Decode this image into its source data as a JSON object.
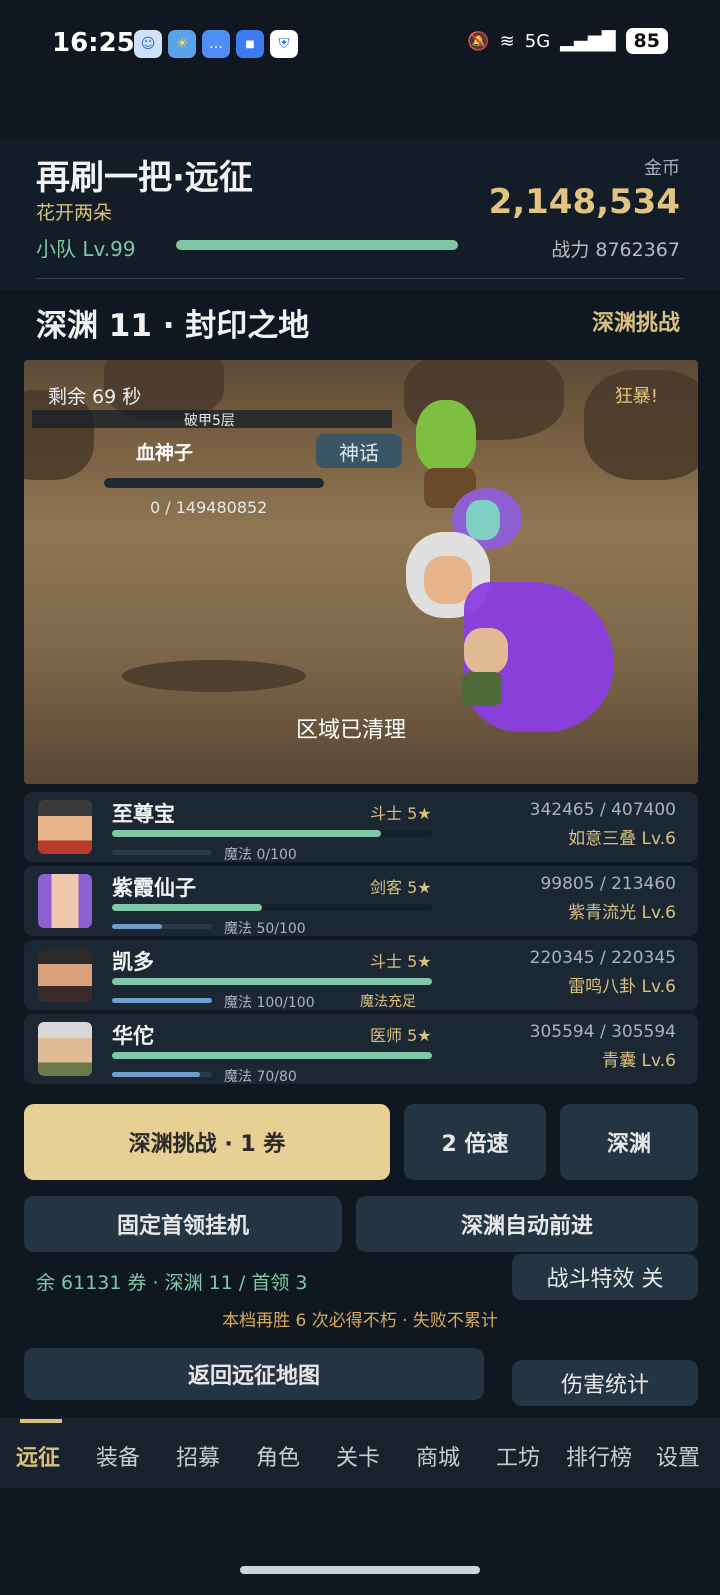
{
  "status_bar": {
    "time": "16:25",
    "signal": "5G",
    "battery": "85"
  },
  "header": {
    "title": "再刷一把·远征",
    "subtitle": "花开两朵",
    "team_level": "小队 Lv.99",
    "gold_label": "金币",
    "gold_value": "2,148,534",
    "power": "战力 8762367"
  },
  "stage": {
    "title": "深渊 11 · 封印之地",
    "challenge_link": "深渊挑战"
  },
  "battle": {
    "timer": "剩余 69 秒",
    "berserk": "狂暴!",
    "armor_break": "破甲5层",
    "boss_name": "血神子",
    "boss_tier": "神话",
    "boss_hp": "0 / 149480852",
    "boss_hp_fraction": 0,
    "status_text": "区域已清理"
  },
  "party": [
    {
      "name": "至尊宝",
      "class": "斗士 5★",
      "hp": "342465 / 407400",
      "hp_frac": 0.84,
      "skill": "如意三叠 Lv.6",
      "mp": "魔法 0/100",
      "mp_frac": 0.0,
      "mp_note": ""
    },
    {
      "name": "紫霞仙子",
      "class": "剑客 5★",
      "hp": "99805 / 213460",
      "hp_frac": 0.47,
      "skill": "紫青流光 Lv.6",
      "mp": "魔法 50/100",
      "mp_frac": 0.5,
      "mp_note": ""
    },
    {
      "name": "凯多",
      "class": "斗士 5★",
      "hp": "220345 / 220345",
      "hp_frac": 1.0,
      "skill": "雷鸣八卦 Lv.6",
      "mp": "魔法 100/100",
      "mp_frac": 1.0,
      "mp_note": "魔法充足"
    },
    {
      "name": "华佗",
      "class": "医师 5★",
      "hp": "305594 / 305594",
      "hp_frac": 1.0,
      "skill": "青囊 Lv.6",
      "mp": "魔法 70/80",
      "mp_frac": 0.875,
      "mp_note": ""
    }
  ],
  "actions": {
    "abyss_challenge": "深渊挑战 · 1 券",
    "speed": "2 倍速",
    "abyss": "深渊",
    "fixed_boss": "固定首领挂机",
    "auto_advance": "深渊自动前进",
    "effects_toggle": "战斗特效 关",
    "return_map": "返回远征地图",
    "damage_stats": "伤害统计"
  },
  "info_line": "余 61131 券 · 深渊 11 / 首领 3",
  "note_line": "本档再胜 6 次必得不朽 · 失败不累计",
  "tabs": [
    "远征",
    "装备",
    "招募",
    "角色",
    "关卡",
    "商城",
    "工坊",
    "排行榜",
    "设置"
  ],
  "colors": {
    "background": "#0f1720",
    "accent_gold": "#e2c481",
    "hp_green": "#7fc7a7",
    "mp_blue": "#6f9fcf",
    "primary_button": "#e8cf94"
  }
}
